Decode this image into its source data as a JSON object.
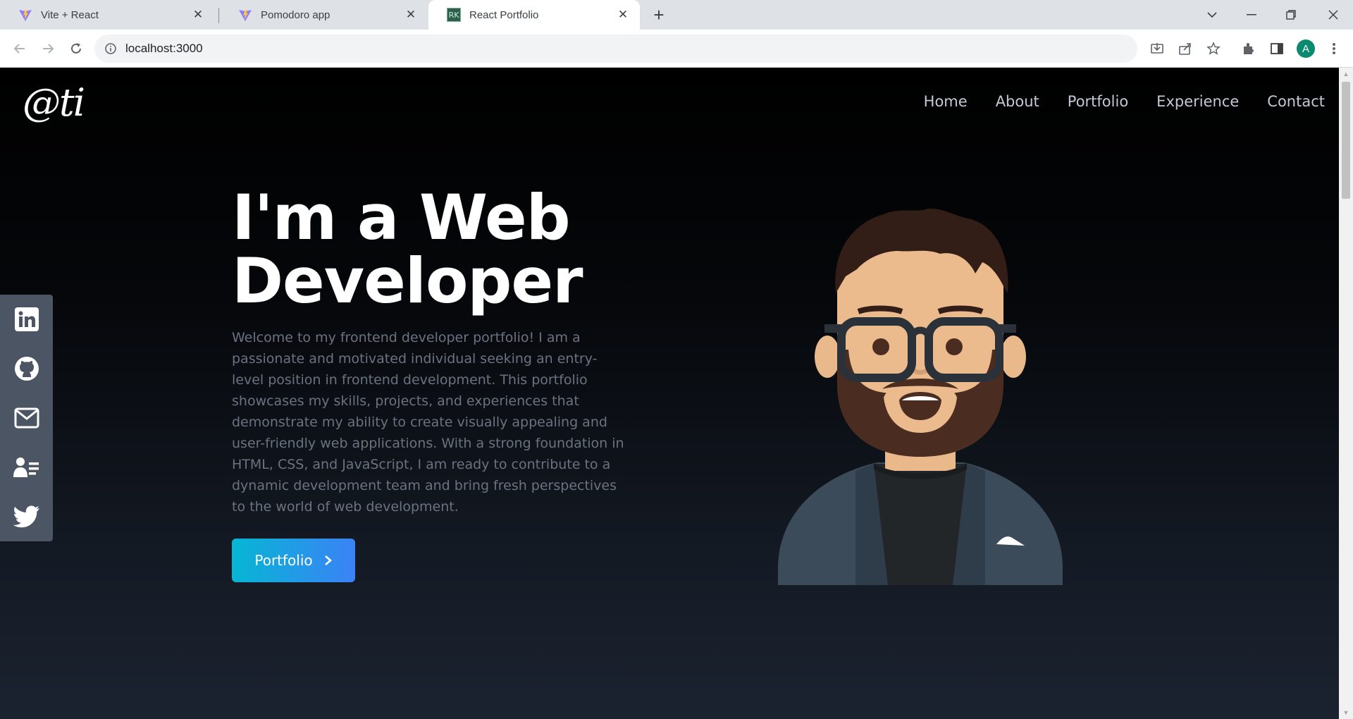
{
  "browser": {
    "tabs": [
      {
        "title": "Vite + React",
        "favicon": "vite-icon"
      },
      {
        "title": "Pomodoro app",
        "favicon": "vite-icon"
      },
      {
        "title": "React Portfolio",
        "favicon": "rk-icon",
        "favicon_text": "RK",
        "active": true
      }
    ],
    "url": "localhost:3000",
    "profile_initial": "A"
  },
  "site": {
    "logo": "@ti",
    "nav": [
      "Home",
      "About",
      "Portfolio",
      "Experience",
      "Contact"
    ],
    "hero": {
      "title_line1": "I'm a Web",
      "title_line2": "Developer",
      "intro": "Welcome to my frontend developer portfolio! I am a passionate and motivated individual seeking an entry-level position in frontend development. This portfolio showcases my skills, projects, and experiences that demonstrate my ability to create visually appealing and user-friendly web applications. With a strong foundation in HTML, CSS, and JavaScript, I am ready to contribute to a dynamic development team and bring fresh perspectives to the world of web development.",
      "cta_label": "Portfolio"
    },
    "social_links": [
      "linkedin-icon",
      "github-icon",
      "mail-icon",
      "resume-icon",
      "twitter-icon"
    ]
  },
  "colors": {
    "cta_gradient_start": "#06b6d4",
    "cta_gradient_end": "#3b82f6",
    "social_bar": "#4b5563",
    "intro_text": "#6b7280"
  }
}
